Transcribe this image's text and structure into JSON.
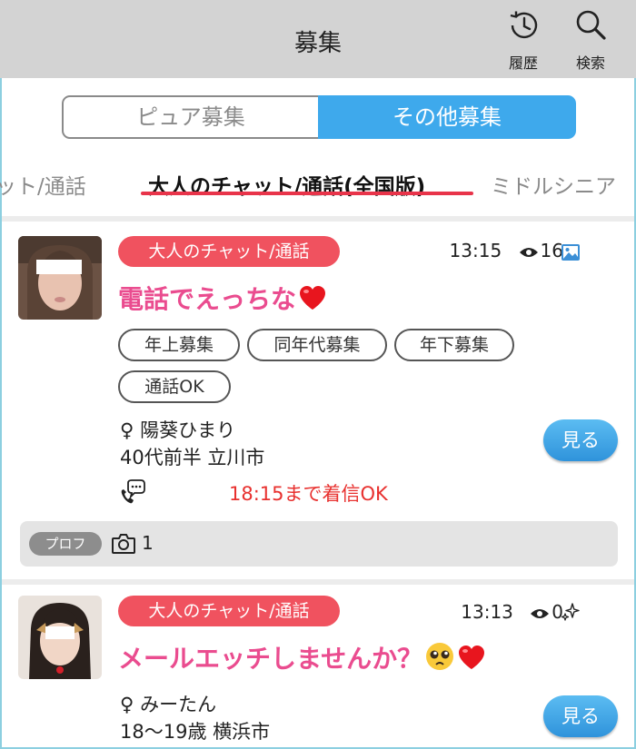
{
  "header": {
    "title": "募集",
    "history_label": "履歴",
    "search_label": "検索"
  },
  "segment": {
    "options": [
      "ピュア募集",
      "その他募集"
    ],
    "selected": "その他募集"
  },
  "tabs": {
    "prev": "ャット/通話",
    "active": "大人のチャット/通話(全国版)",
    "next": "ミドルシニア"
  },
  "posts": [
    {
      "category": "大人のチャット/通話",
      "time": "13:15",
      "views": "16",
      "meta_icon": "image-icon",
      "title": "電話でえっちな",
      "title_emojis": [
        "heart-icon"
      ],
      "tags": [
        "年上募集",
        "同年代募集",
        "年下募集",
        "通話OK"
      ],
      "gender_symbol": "♀",
      "name": "陽葵ひまり",
      "age_location": "40代前半 立川市",
      "call_status": "18:15まで着信OK",
      "view_button": "見る",
      "profile_label": "プロフ",
      "photo_count": "1"
    },
    {
      "category": "大人のチャット/通話",
      "time": "13:13",
      "views": "0",
      "meta_icon": "sparkles-icon",
      "title": "メールエッチしませんか？",
      "title_emojis": [
        "pleading-face-icon",
        "heart-icon"
      ],
      "gender_symbol": "♀",
      "name": "みーたん",
      "age_location": "18〜19歳 横浜市",
      "view_button": "見る"
    }
  ],
  "colors": {
    "header_bg": "#d3d3d3",
    "accent_blue": "#3ea9ec",
    "category_red": "#f0525f",
    "title_pink": "#ea4c8f",
    "call_red": "#e8302e",
    "tab_underline": "#e8344a"
  }
}
